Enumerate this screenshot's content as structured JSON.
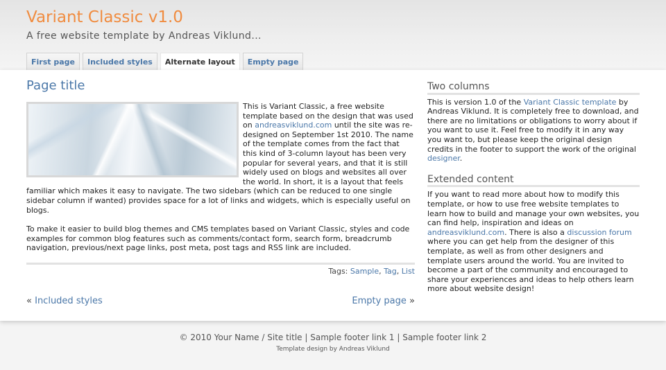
{
  "header": {
    "title": "Variant Classic v1.0",
    "subtitle": "A free website template by Andreas Viklund..."
  },
  "tabs": [
    {
      "label": "First page"
    },
    {
      "label": "Included styles"
    },
    {
      "label": "Alternate layout"
    },
    {
      "label": "Empty page"
    }
  ],
  "content": {
    "page_title": "Page title",
    "p1_a": "This is Variant Classic, a free website template based on the design that was used on ",
    "p1_link": "andreasviklund.com",
    "p1_b": " until the site was re-designed on September 1st 2010. The name of the template comes from the fact that this kind of 3-column layout has been very popular for several years, and that it is still widely used on blogs and websites all over the world. In short, it is a layout that feels familiar which makes it easy to navigate. The two sidebars (which can be reduced to one single sidebar column if wanted) provides space for a lot of links and widgets, which is especially useful on blogs.",
    "p2": "To make it easier to build blog themes and CMS templates based on Variant Classic, styles and code examples for common blog features such as comments/contact form, search form, breadcrumb navigation, previous/next page links, post meta, post tags and RSS link are included.",
    "tags_label": "Tags:",
    "tags": [
      "Sample",
      "Tag",
      "List"
    ],
    "prev_arrow": "«",
    "prev_label": "Included styles",
    "next_label": "Empty page",
    "next_arrow": "»"
  },
  "sidebar": {
    "two_columns": {
      "heading": "Two columns",
      "t1": "This is version 1.0 of the ",
      "link1": "Variant Classic template",
      "t2": " by Andreas Viklund. It is completely free to download, and there are no limitations or obligations to worry about if you want to use it. Feel free to modify it in any way you want to, but please keep the original design credits in the footer to support the work of the original ",
      "link2": "designer",
      "t3": "."
    },
    "extended": {
      "heading": "Extended content",
      "t1": "If you want to read more about how to modify this template, or how to use free website templates to learn how to build and manage your own websites, you can find help, inspiration and ideas on ",
      "link1": "andreasviklund.com",
      "t2": ". There is also a ",
      "link2": "discussion forum",
      "t3": " where you can get help from the designer of this template, as well as from other designers and template users around the world. You are invited to become a part of the community and encouraged to share your experiences and ideas to help others learn more about website design!"
    }
  },
  "footer": {
    "copyright": "© 2010 Your Name / Site title",
    "sep": "|",
    "link1": "Sample footer link 1",
    "link2": "Sample footer link 2",
    "credit": "Template design by Andreas Viklund"
  },
  "colors": {
    "accent_title": "#f08c40",
    "link": "#4a77a8"
  }
}
